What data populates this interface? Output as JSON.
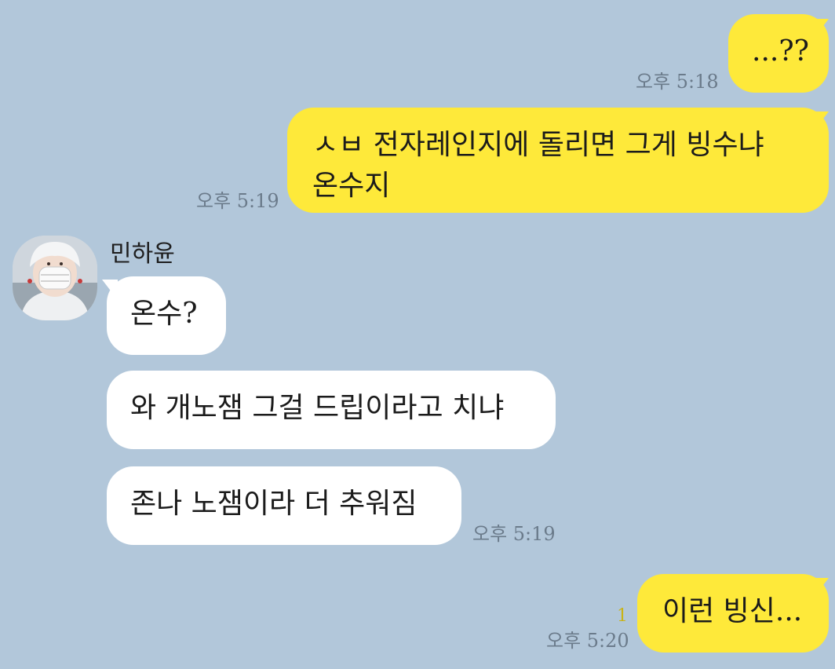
{
  "messages": [
    {
      "sender": "me",
      "text": "...??",
      "time": "오후 5:18"
    },
    {
      "sender": "me",
      "text_line1": "ㅅㅂ 전자레인지에 돌리면 그게 빙수냐",
      "text_line2": "온수지",
      "time": "오후 5:19"
    },
    {
      "sender": "other",
      "name": "민하윤",
      "text": "온수?"
    },
    {
      "sender": "other",
      "text": "와 개노잼 그걸 드립이라고 치냐"
    },
    {
      "sender": "other",
      "text": "존나 노잼이라 더 추워짐",
      "time": "오후 5:19"
    },
    {
      "sender": "me",
      "text": "이런 빙신...",
      "time": "오후 5:20",
      "unread": "1"
    }
  ],
  "colors": {
    "background": "#b2c7da",
    "my_bubble": "#fee93a",
    "other_bubble": "#ffffff",
    "timestamp": "#6b7b8b",
    "unread": "#c9b316"
  },
  "icons": {
    "avatar": "profile-photo-avatar"
  }
}
